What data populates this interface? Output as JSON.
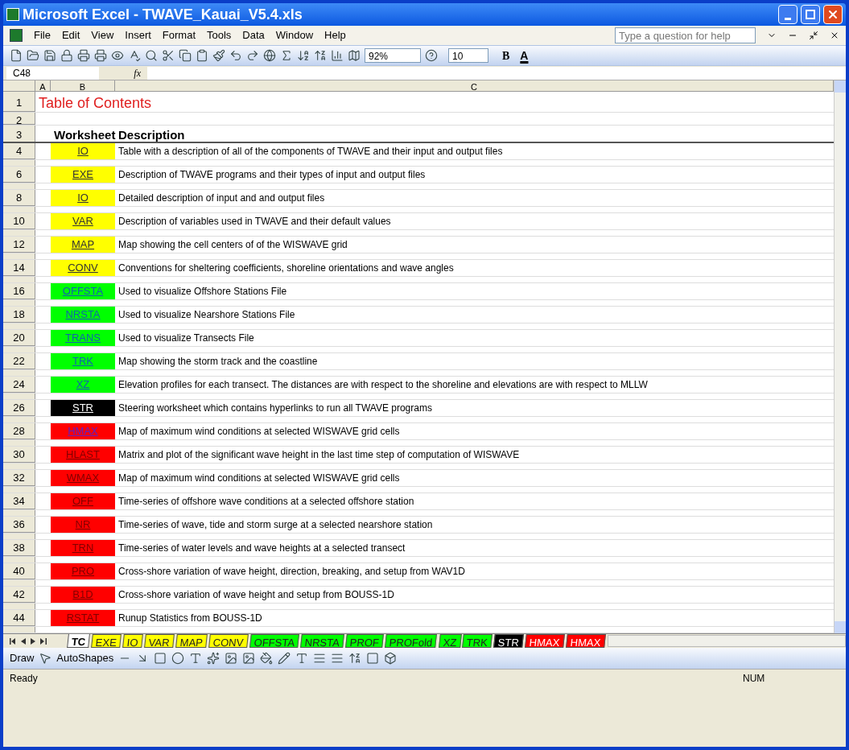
{
  "window": {
    "title": "Microsoft Excel - TWAVE_Kauai_V5.4.xls"
  },
  "menu": [
    "File",
    "Edit",
    "View",
    "Insert",
    "Format",
    "Tools",
    "Data",
    "Window",
    "Help"
  ],
  "help_search": {
    "placeholder": "Type a question for help"
  },
  "toolbar": {
    "zoom": "92%",
    "font_size": "10",
    "bold": "B",
    "font_color": "A"
  },
  "formula_bar": {
    "name_box": "C48",
    "fx": "fx"
  },
  "columns": [
    "A",
    "B",
    "C"
  ],
  "sheet": {
    "title_row": "1",
    "title": "Table of Contents",
    "blank_row": "2",
    "header_row": "3",
    "headers": [
      "Worksheet",
      "Description"
    ]
  },
  "rows": [
    {
      "row": "4",
      "link": "IO",
      "color": "#ffff00",
      "visited": false,
      "description": "Table with a description of all of the components of TWAVE and their input and output files"
    },
    {
      "row": "6",
      "link": "EXE",
      "color": "#ffff00",
      "visited": false,
      "description": "Description of TWAVE programs and their types of input and output files"
    },
    {
      "row": "8",
      "link": "IO",
      "color": "#ffff00",
      "visited": false,
      "description": "Detailed description of input and and output files"
    },
    {
      "row": "10",
      "link": "VAR",
      "color": "#ffff00",
      "visited": false,
      "description": "Description of variables used in TWAVE and their default values"
    },
    {
      "row": "12",
      "link": "MAP",
      "color": "#ffff00",
      "visited": false,
      "description": "Map showing the cell centers of of the WISWAVE grid"
    },
    {
      "row": "14",
      "link": "CONV",
      "color": "#ffff00",
      "visited": false,
      "description": "Conventions for sheltering coefficients, shoreline orientations and wave angles"
    },
    {
      "row": "16",
      "link": "OFFSTA",
      "color": "#00ff00",
      "visited": false,
      "description": "Used to visualize Offshore Stations File"
    },
    {
      "row": "18",
      "link": "NRSTA",
      "color": "#00ff00",
      "visited": false,
      "description": "Used to visualize Nearshore Stations File"
    },
    {
      "row": "20",
      "link": "TRANS",
      "color": "#00ff00",
      "visited": false,
      "description": "Used to visualize Transects File"
    },
    {
      "row": "22",
      "link": "TRK",
      "color": "#00ff00",
      "visited": false,
      "description": "Map showing  the storm track and the coastline"
    },
    {
      "row": "24",
      "link": "XZ",
      "color": "#00ff00",
      "visited": false,
      "description": "Elevation profiles for each transect. The distances are with respect to the shoreline and elevations are with respect to MLLW"
    },
    {
      "row": "26",
      "link": "STR",
      "color": "#000000",
      "visited": false,
      "description": "Steering worksheet which contains hyperlinks to run all TWAVE programs"
    },
    {
      "row": "28",
      "link": "HMAX",
      "color": "#ff0000",
      "visited": true,
      "description": "Map of maximum wind conditions at selected WISWAVE grid cells"
    },
    {
      "row": "30",
      "link": "HLAST",
      "color": "#ff0000",
      "visited": false,
      "description": "Matrix and plot of the significant wave height in the last time step of computation of WISWAVE"
    },
    {
      "row": "32",
      "link": "WMAX",
      "color": "#ff0000",
      "visited": false,
      "description": "Map of maximum wind conditions at selected WISWAVE grid cells"
    },
    {
      "row": "34",
      "link": "OFF",
      "color": "#ff0000",
      "visited": false,
      "description": "Time-series of offshore wave conditions at a selected offshore station"
    },
    {
      "row": "36",
      "link": "NR",
      "color": "#ff0000",
      "visited": false,
      "description": "Time-series of wave, tide and storm surge at a selected nearshore station"
    },
    {
      "row": "38",
      "link": "TRN",
      "color": "#ff0000",
      "visited": false,
      "description": "Time-series of water levels and wave heights at a selected transect"
    },
    {
      "row": "40",
      "link": "PRO",
      "color": "#ff0000",
      "visited": false,
      "description": "Cross-shore variation of wave height, direction, breaking, and setup from WAV1D"
    },
    {
      "row": "42",
      "link": "B1D",
      "color": "#ff0000",
      "visited": false,
      "description": "Cross-shore variation of wave height and setup from BOUSS-1D"
    },
    {
      "row": "44",
      "link": "RSTAT",
      "color": "#ff0000",
      "visited": false,
      "description": "Runup Statistics from BOUSS-1D"
    }
  ],
  "sheet_tabs": [
    {
      "label": "TC",
      "color": "#ffffff",
      "selected": true
    },
    {
      "label": "EXE",
      "color": "#ffff00",
      "selected": false
    },
    {
      "label": "IO",
      "color": "#ffff00",
      "selected": false
    },
    {
      "label": "VAR",
      "color": "#ffff00",
      "selected": false
    },
    {
      "label": "MAP",
      "color": "#ffff00",
      "selected": false
    },
    {
      "label": "CONV",
      "color": "#ffff00",
      "selected": false
    },
    {
      "label": "OFFSTA",
      "color": "#00ff00",
      "selected": false
    },
    {
      "label": "NRSTA",
      "color": "#00ff00",
      "selected": false
    },
    {
      "label": "PROF",
      "color": "#00ff00",
      "selected": false
    },
    {
      "label": "PROFold",
      "color": "#00ff00",
      "selected": false
    },
    {
      "label": "XZ",
      "color": "#00ff00",
      "selected": false
    },
    {
      "label": "TRK",
      "color": "#00ff00",
      "selected": false
    },
    {
      "label": "STR",
      "color": "#000000",
      "selected": false
    },
    {
      "label": "HMAX",
      "color": "#ff0000",
      "selected": false
    },
    {
      "label": "HMAX",
      "color": "#ff0000",
      "selected": false
    }
  ],
  "drawing_toolbar": {
    "draw": "Draw",
    "autoshapes": "AutoShapes"
  },
  "status_bar": {
    "status": "Ready",
    "num": "NUM"
  }
}
